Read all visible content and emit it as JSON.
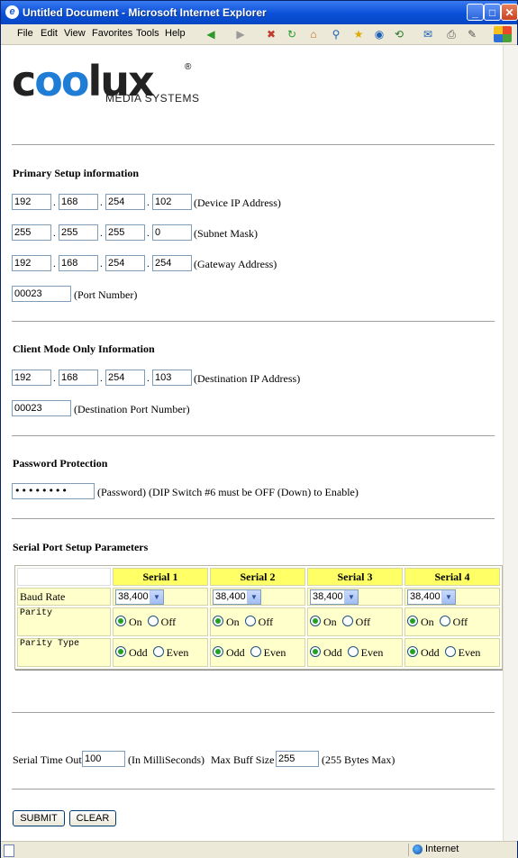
{
  "window": {
    "title": "Untitled Document - Microsoft Internet Explorer",
    "menu": [
      "File",
      "Edit",
      "View",
      "Favorites",
      "Tools",
      "Help"
    ]
  },
  "logo": {
    "word_left": "c",
    "word_blue": "oo",
    "word_right": "lux",
    "reg": "®",
    "subtitle": "MEDIA SYSTEMS"
  },
  "primary": {
    "heading": "Primary Setup information",
    "device_ip": [
      "192",
      "168",
      "254",
      "102"
    ],
    "device_ip_label": "(Device IP Address)",
    "subnet": [
      "255",
      "255",
      "255",
      "0"
    ],
    "subnet_label": "(Subnet Mask)",
    "gateway": [
      "192",
      "168",
      "254",
      "254"
    ],
    "gateway_label": "(Gateway Address)",
    "port": "00023",
    "port_label": "(Port Number)"
  },
  "client": {
    "heading": "Client Mode Only Information",
    "dest_ip": [
      "192",
      "168",
      "254",
      "103"
    ],
    "dest_ip_label": "(Destination IP Address)",
    "dest_port": "00023",
    "dest_port_label": "(Destination Port Number)"
  },
  "password": {
    "heading": "Password Protection",
    "value": "••••••••",
    "label": "(Password) (DIP Switch #6 must be OFF (Down) to Enable)"
  },
  "serial": {
    "heading": "Serial Port Setup Parameters",
    "columns": [
      "Serial 1",
      "Serial 2",
      "Serial 3",
      "Serial 4"
    ],
    "rows": {
      "baud_label": "Baud Rate",
      "baud": [
        "38,400",
        "38,400",
        "38,400",
        "38,400"
      ],
      "parity_label": "Parity",
      "parity_on": "On",
      "parity_off": "Off",
      "parity_type_label": "Parity Type",
      "odd": "Odd",
      "even": "Even"
    }
  },
  "timeout": {
    "label": "Serial Time Out",
    "value": "100",
    "unit": "(In MilliSeconds)",
    "buff_label": "Max Buff Size",
    "buff_value": "255",
    "buff_unit": "(255 Bytes Max)"
  },
  "buttons": {
    "submit": "SUBMIT",
    "clear": "CLEAR"
  },
  "status": {
    "zone": "Internet"
  }
}
